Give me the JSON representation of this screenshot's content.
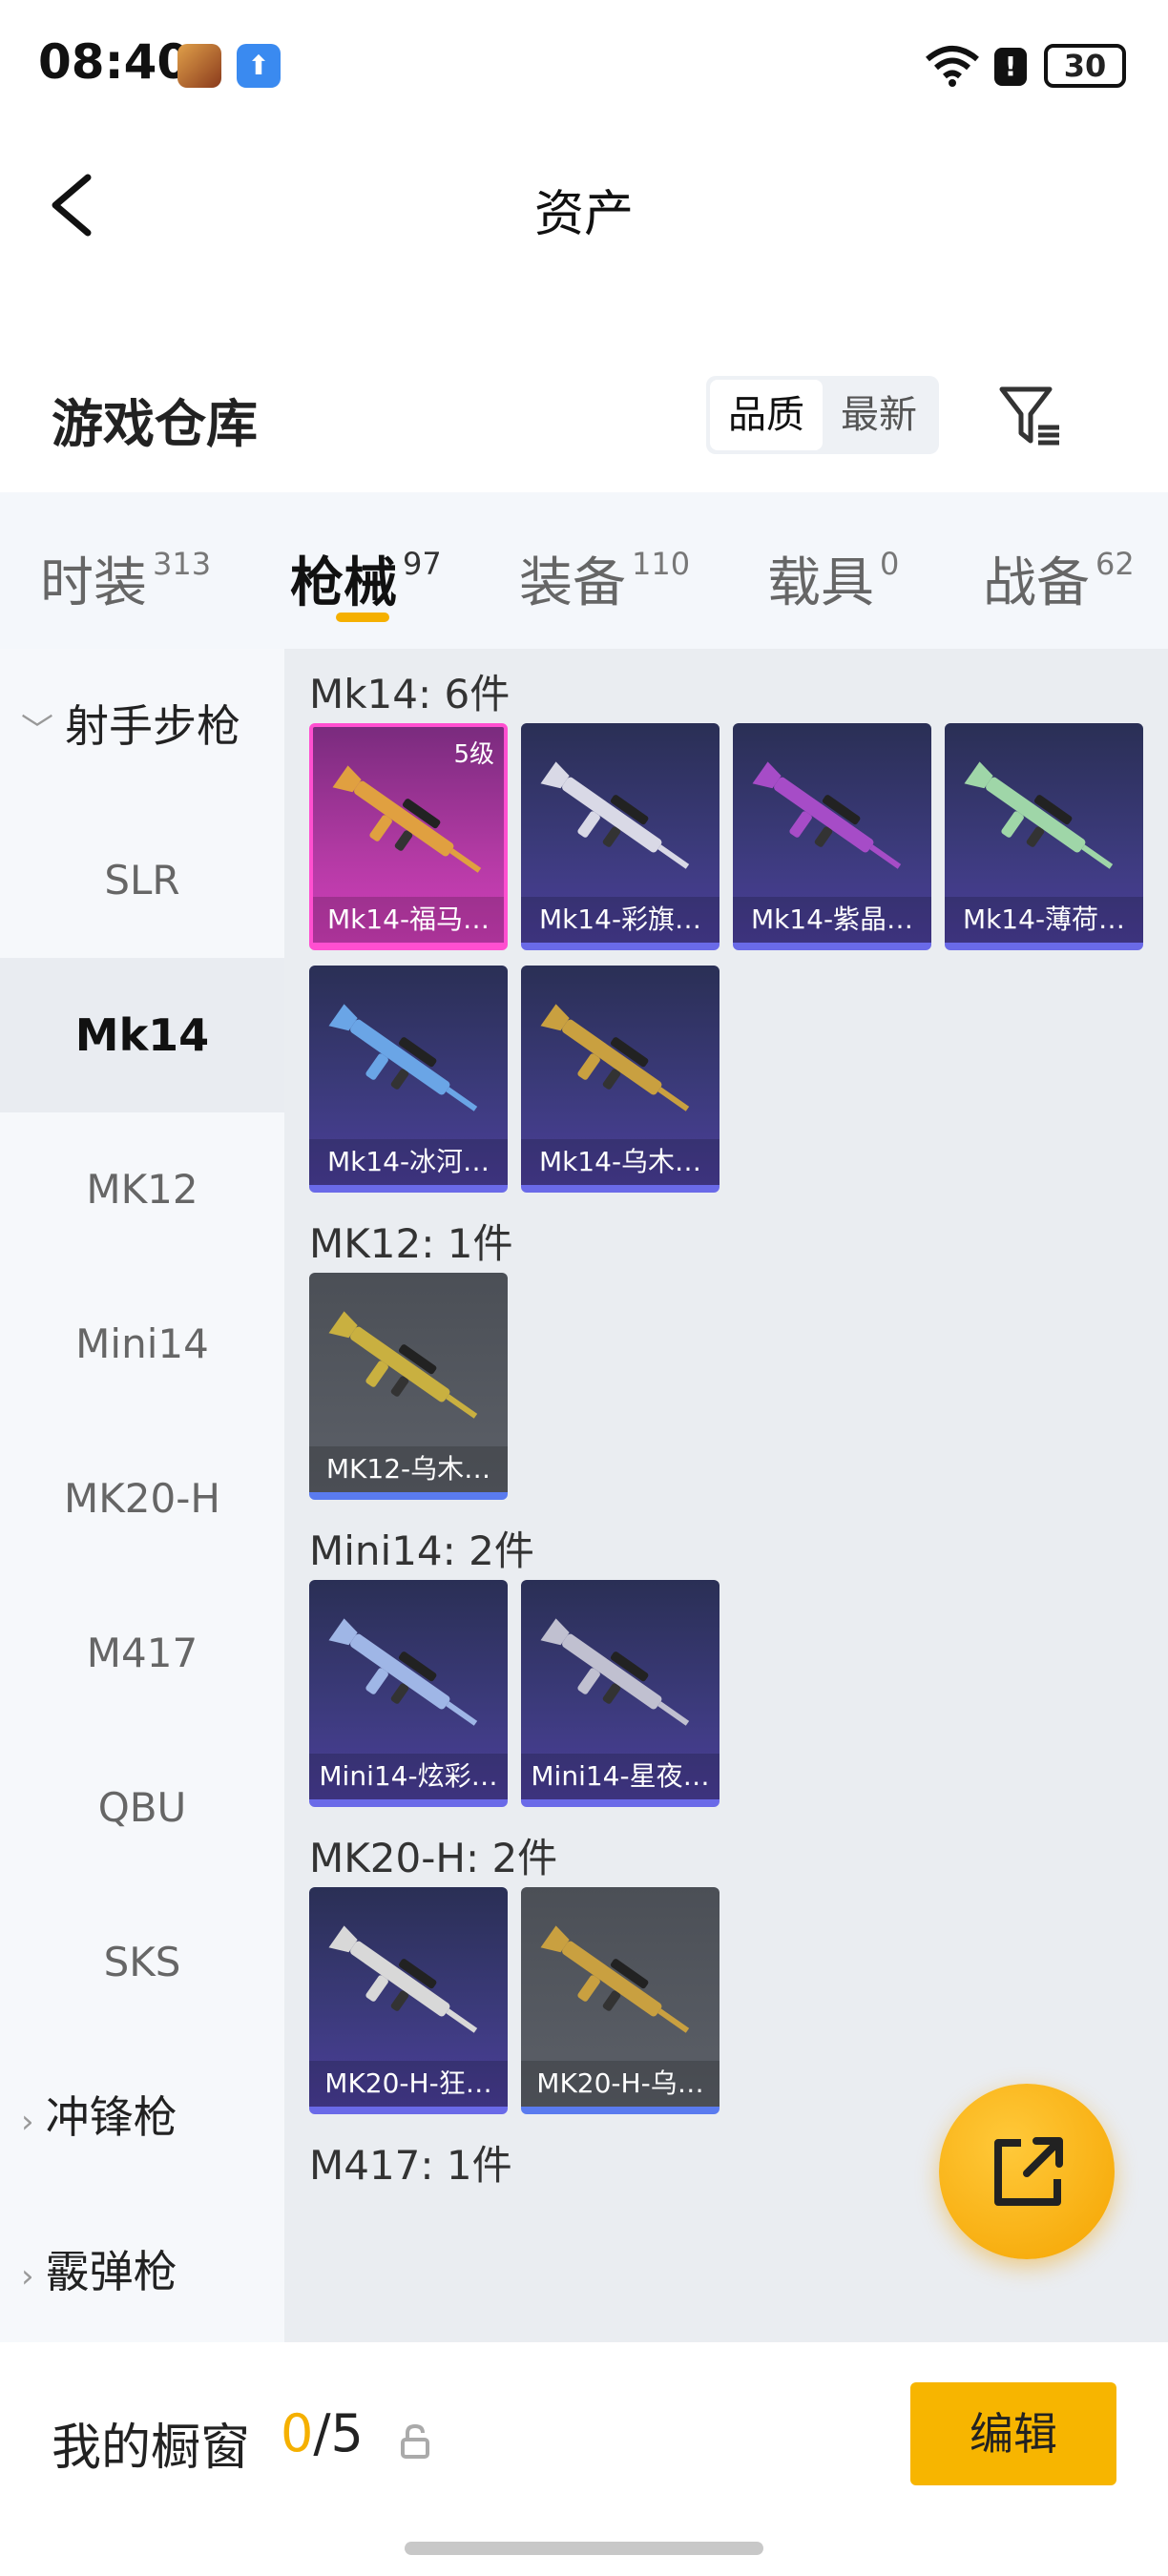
{
  "status_bar": {
    "time": "08:40",
    "battery": "30"
  },
  "header": {
    "title": "资产"
  },
  "warehouse": {
    "title": "游戏仓库",
    "sort_options": [
      "品质",
      "最新"
    ],
    "active_sort": "品质"
  },
  "tabs": [
    {
      "label": "时装",
      "count": "313"
    },
    {
      "label": "枪械",
      "count": "97",
      "active": true
    },
    {
      "label": "装备",
      "count": "110"
    },
    {
      "label": "载具",
      "count": "0"
    },
    {
      "label": "战备",
      "count": "62"
    }
  ],
  "sidebar": {
    "group_open": "射手步枪",
    "items": [
      "SLR",
      "Mk14",
      "MK12",
      "Mini14",
      "MK20-H",
      "M417",
      "QBU",
      "SKS"
    ],
    "active_item": "Mk14",
    "groups_closed": [
      "冲锋枪",
      "霰弹枪"
    ]
  },
  "sections": [
    {
      "title": "Mk14: 6件",
      "items": [
        {
          "name": "Mk14-福马…",
          "quality": "pink",
          "level": "5级"
        },
        {
          "name": "Mk14-彩旗…",
          "quality": "purple"
        },
        {
          "name": "Mk14-紫晶…",
          "quality": "purple"
        },
        {
          "name": "Mk14-薄荷…",
          "quality": "purple"
        },
        {
          "name": "Mk14-冰河…",
          "quality": "purple"
        },
        {
          "name": "Mk14-乌木…",
          "quality": "purple"
        }
      ]
    },
    {
      "title": "MK12: 1件",
      "items": [
        {
          "name": "MK12-乌木…",
          "quality": "gray"
        }
      ]
    },
    {
      "title": "Mini14: 2件",
      "items": [
        {
          "name": "Mini14-炫彩…",
          "quality": "purple"
        },
        {
          "name": "Mini14-星夜…",
          "quality": "purple"
        }
      ]
    },
    {
      "title": "MK20-H: 2件",
      "items": [
        {
          "name": "MK20-H-狂…",
          "quality": "purple"
        },
        {
          "name": "MK20-H-乌…",
          "quality": "gray"
        }
      ]
    },
    {
      "title": "M417: 1件",
      "items": []
    }
  ],
  "showcase": {
    "label": "我的橱窗",
    "current": "0",
    "total": "/5",
    "edit_label": "编辑"
  },
  "colors": {
    "accent": "#f5b000",
    "pink_quality": "#ff4fd0",
    "purple_quality": "#6a6ae8"
  }
}
